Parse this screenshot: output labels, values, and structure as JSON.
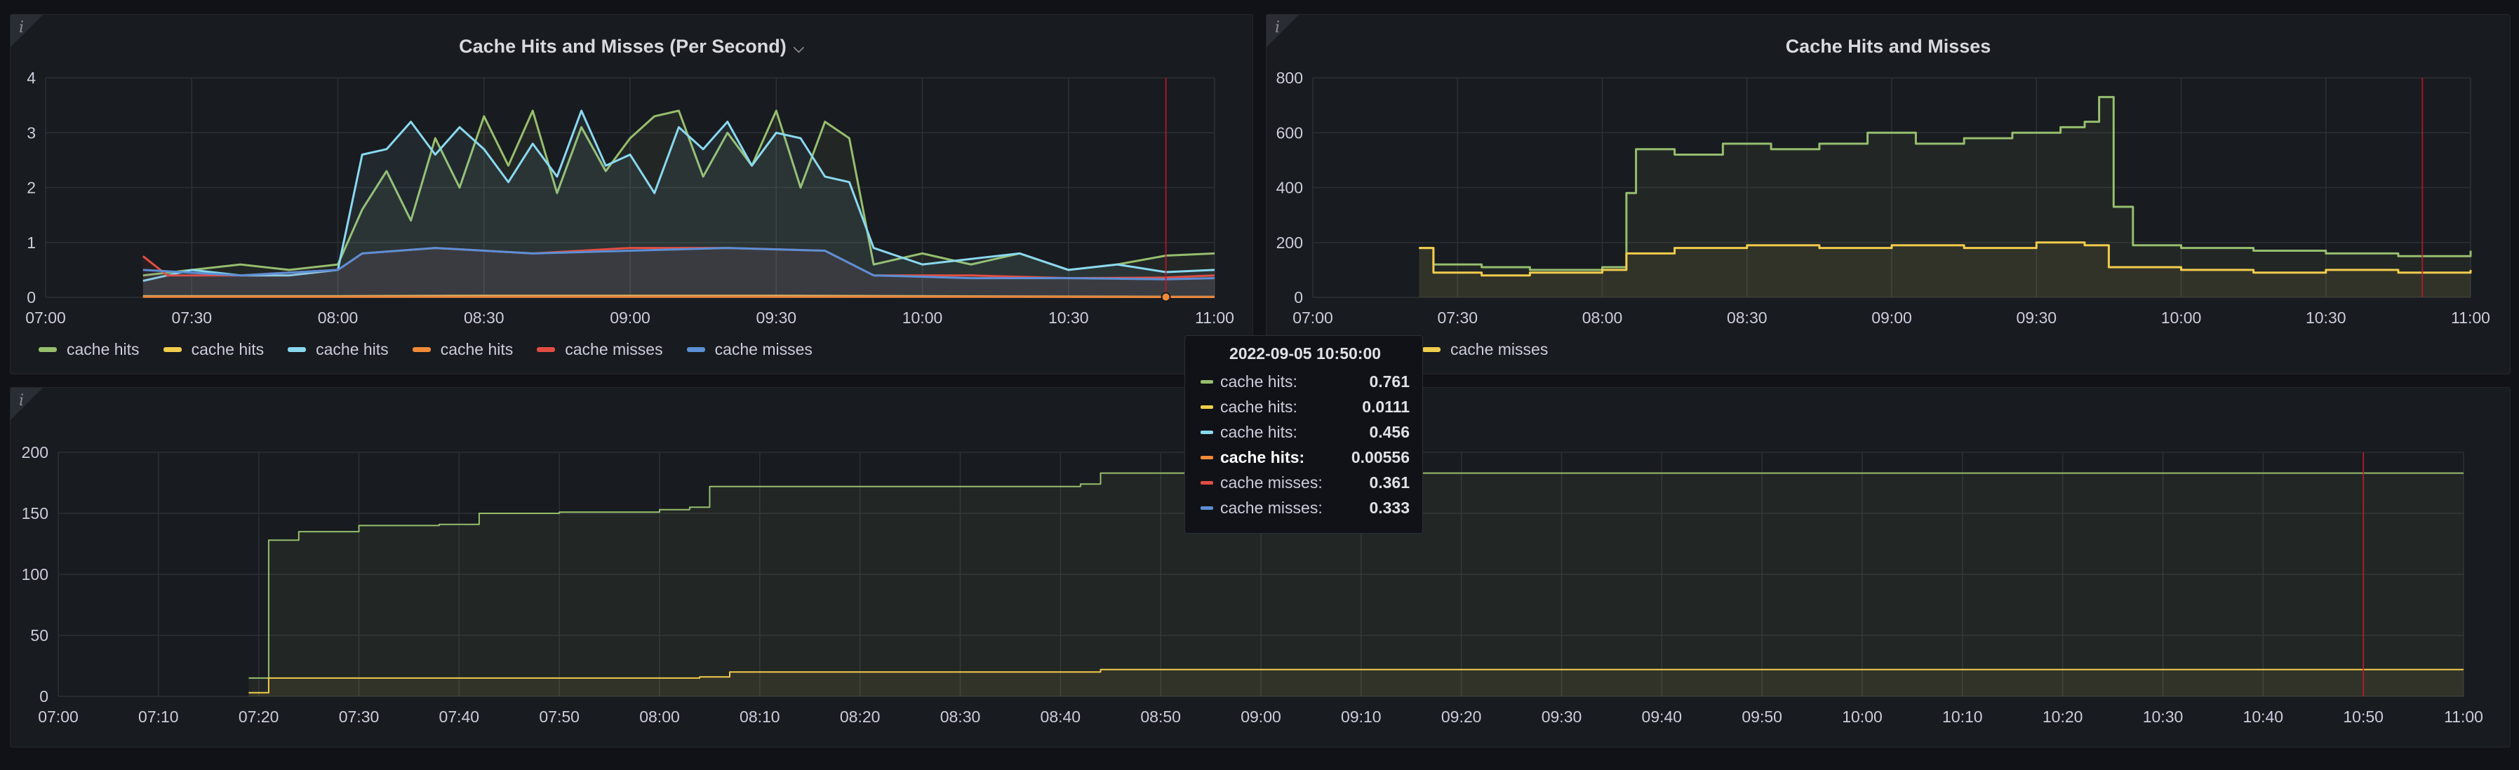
{
  "panels": {
    "top_left": {
      "title": "Cache Hits and Misses (Per Second)",
      "chevron": "⌵",
      "info_icon": "i"
    },
    "top_right": {
      "title": "Cache Hits and Misses",
      "info_icon": "i"
    },
    "bottom": {
      "title": "",
      "info_icon": "i"
    }
  },
  "legend": [
    {
      "label": "cache hits",
      "color": "#96be6e"
    },
    {
      "label": "cache hits",
      "color": "#f2cc4c"
    },
    {
      "label": "cache hits",
      "color": "#8ad8f0"
    },
    {
      "label": "cache hits",
      "color": "#f08a38"
    },
    {
      "label": "cache misses",
      "color": "#e24d42"
    },
    {
      "label": "cache misses",
      "color": "#5b8fd6"
    }
  ],
  "legend_right_partial": {
    "label": "cache misses",
    "color": "#f2cc4c"
  },
  "tooltip": {
    "time": "2022-09-05 10:50:00",
    "rows": [
      {
        "label": "cache hits:",
        "value": "0.761",
        "color": "#96be6e",
        "highlight": false
      },
      {
        "label": "cache hits:",
        "value": "0.0111",
        "color": "#f2cc4c",
        "highlight": false
      },
      {
        "label": "cache hits:",
        "value": "0.456",
        "color": "#8ad8f0",
        "highlight": false
      },
      {
        "label": "cache hits:",
        "value": "0.00556",
        "color": "#f08a38",
        "highlight": true
      },
      {
        "label": "cache misses:",
        "value": "0.361",
        "color": "#e24d42",
        "highlight": false
      },
      {
        "label": "cache misses:",
        "value": "0.333",
        "color": "#5b8fd6",
        "highlight": false
      }
    ]
  },
  "chart_data": [
    {
      "id": "rate",
      "type": "line",
      "title": "Cache Hits and Misses (Per Second)",
      "ylim": [
        0,
        4
      ],
      "yticks": [
        0,
        1,
        2,
        3,
        4
      ],
      "xlim": [
        "07:00",
        "11:00"
      ],
      "xticks": [
        "07:00",
        "07:30",
        "08:00",
        "08:30",
        "09:00",
        "09:30",
        "10:00",
        "10:30",
        "11:00"
      ],
      "cursor": "10:50",
      "grid": true,
      "legend_position": "bottom",
      "series": [
        {
          "name": "cache hits",
          "color": "#96be6e",
          "points": [
            [
              "07:20",
              0.4
            ],
            [
              "07:30",
              0.5
            ],
            [
              "07:40",
              0.6
            ],
            [
              "07:50",
              0.5
            ],
            [
              "08:00",
              0.6
            ],
            [
              "08:05",
              1.6
            ],
            [
              "08:10",
              2.3
            ],
            [
              "08:15",
              1.4
            ],
            [
              "08:20",
              2.9
            ],
            [
              "08:25",
              2.0
            ],
            [
              "08:30",
              3.3
            ],
            [
              "08:35",
              2.4
            ],
            [
              "08:40",
              3.4
            ],
            [
              "08:45",
              1.9
            ],
            [
              "08:50",
              3.1
            ],
            [
              "08:55",
              2.3
            ],
            [
              "09:00",
              2.9
            ],
            [
              "09:05",
              3.3
            ],
            [
              "09:10",
              3.4
            ],
            [
              "09:15",
              2.2
            ],
            [
              "09:20",
              3.0
            ],
            [
              "09:25",
              2.4
            ],
            [
              "09:30",
              3.4
            ],
            [
              "09:35",
              2.0
            ],
            [
              "09:40",
              3.2
            ],
            [
              "09:45",
              2.9
            ],
            [
              "09:50",
              0.6
            ],
            [
              "10:00",
              0.8
            ],
            [
              "10:10",
              0.6
            ],
            [
              "10:20",
              0.8
            ],
            [
              "10:30",
              0.5
            ],
            [
              "10:40",
              0.6
            ],
            [
              "10:50",
              0.76
            ],
            [
              "11:00",
              0.8
            ]
          ]
        },
        {
          "name": "cache hits",
          "color": "#f2cc4c",
          "points": [
            [
              "07:20",
              0.02
            ],
            [
              "08:00",
              0.02
            ],
            [
              "08:30",
              0.03
            ],
            [
              "09:00",
              0.03
            ],
            [
              "09:30",
              0.03
            ],
            [
              "10:00",
              0.02
            ],
            [
              "10:50",
              0.01
            ],
            [
              "11:00",
              0.01
            ]
          ]
        },
        {
          "name": "cache hits",
          "color": "#8ad8f0",
          "points": [
            [
              "07:20",
              0.3
            ],
            [
              "07:30",
              0.5
            ],
            [
              "07:40",
              0.4
            ],
            [
              "07:50",
              0.4
            ],
            [
              "08:00",
              0.5
            ],
            [
              "08:05",
              2.6
            ],
            [
              "08:10",
              2.7
            ],
            [
              "08:15",
              3.2
            ],
            [
              "08:20",
              2.6
            ],
            [
              "08:25",
              3.1
            ],
            [
              "08:30",
              2.7
            ],
            [
              "08:35",
              2.1
            ],
            [
              "08:40",
              2.8
            ],
            [
              "08:45",
              2.2
            ],
            [
              "08:50",
              3.4
            ],
            [
              "08:55",
              2.4
            ],
            [
              "09:00",
              2.6
            ],
            [
              "09:05",
              1.9
            ],
            [
              "09:10",
              3.1
            ],
            [
              "09:15",
              2.7
            ],
            [
              "09:20",
              3.2
            ],
            [
              "09:25",
              2.4
            ],
            [
              "09:30",
              3.0
            ],
            [
              "09:35",
              2.9
            ],
            [
              "09:40",
              2.2
            ],
            [
              "09:45",
              2.1
            ],
            [
              "09:50",
              0.9
            ],
            [
              "10:00",
              0.6
            ],
            [
              "10:10",
              0.7
            ],
            [
              "10:20",
              0.8
            ],
            [
              "10:30",
              0.5
            ],
            [
              "10:40",
              0.6
            ],
            [
              "10:50",
              0.46
            ],
            [
              "11:00",
              0.5
            ]
          ]
        },
        {
          "name": "cache hits",
          "color": "#f08a38",
          "points": [
            [
              "07:20",
              0.01
            ],
            [
              "08:00",
              0.01
            ],
            [
              "09:00",
              0.01
            ],
            [
              "10:00",
              0.01
            ],
            [
              "10:50",
              0.006
            ],
            [
              "11:00",
              0.006
            ]
          ]
        },
        {
          "name": "cache misses",
          "color": "#e24d42",
          "points": [
            [
              "07:20",
              0.75
            ],
            [
              "07:25",
              0.4
            ],
            [
              "07:40",
              0.4
            ],
            [
              "08:00",
              0.5
            ],
            [
              "08:05",
              0.8
            ],
            [
              "08:20",
              0.9
            ],
            [
              "08:40",
              0.8
            ],
            [
              "09:00",
              0.9
            ],
            [
              "09:20",
              0.9
            ],
            [
              "09:40",
              0.85
            ],
            [
              "09:50",
              0.4
            ],
            [
              "10:10",
              0.4
            ],
            [
              "10:30",
              0.35
            ],
            [
              "10:50",
              0.36
            ],
            [
              "11:00",
              0.4
            ]
          ]
        },
        {
          "name": "cache misses",
          "color": "#5b8fd6",
          "points": [
            [
              "07:20",
              0.5
            ],
            [
              "07:40",
              0.4
            ],
            [
              "08:00",
              0.5
            ],
            [
              "08:05",
              0.8
            ],
            [
              "08:20",
              0.9
            ],
            [
              "08:40",
              0.8
            ],
            [
              "09:00",
              0.85
            ],
            [
              "09:20",
              0.9
            ],
            [
              "09:40",
              0.85
            ],
            [
              "09:50",
              0.4
            ],
            [
              "10:10",
              0.35
            ],
            [
              "10:30",
              0.35
            ],
            [
              "10:50",
              0.33
            ],
            [
              "11:00",
              0.35
            ]
          ]
        }
      ]
    },
    {
      "id": "count_step",
      "type": "line",
      "title": "Cache Hits and Misses",
      "ylim": [
        0,
        800
      ],
      "yticks": [
        0,
        200,
        400,
        600,
        800
      ],
      "xlim": [
        "07:00",
        "11:00"
      ],
      "xticks": [
        "07:00",
        "07:30",
        "08:00",
        "08:30",
        "09:00",
        "09:30",
        "10:00",
        "10:30",
        "11:00"
      ],
      "cursor": "10:50",
      "grid": true,
      "series": [
        {
          "name": "cache hits",
          "color": "#96be6e",
          "points": [
            [
              "07:22",
              180
            ],
            [
              "07:25",
              120
            ],
            [
              "07:35",
              110
            ],
            [
              "07:45",
              100
            ],
            [
              "08:00",
              110
            ],
            [
              "08:05",
              380
            ],
            [
              "08:07",
              540
            ],
            [
              "08:15",
              520
            ],
            [
              "08:25",
              560
            ],
            [
              "08:35",
              540
            ],
            [
              "08:45",
              560
            ],
            [
              "08:55",
              600
            ],
            [
              "09:05",
              560
            ],
            [
              "09:15",
              580
            ],
            [
              "09:25",
              600
            ],
            [
              "09:35",
              620
            ],
            [
              "09:40",
              640
            ],
            [
              "09:43",
              730
            ],
            [
              "09:46",
              330
            ],
            [
              "09:50",
              190
            ],
            [
              "10:00",
              180
            ],
            [
              "10:15",
              170
            ],
            [
              "10:30",
              160
            ],
            [
              "10:45",
              150
            ],
            [
              "11:00",
              170
            ]
          ]
        },
        {
          "name": "cache misses",
          "color": "#f2cc4c",
          "points": [
            [
              "07:22",
              180
            ],
            [
              "07:25",
              90
            ],
            [
              "07:35",
              80
            ],
            [
              "07:45",
              90
            ],
            [
              "08:00",
              100
            ],
            [
              "08:05",
              160
            ],
            [
              "08:15",
              180
            ],
            [
              "08:30",
              190
            ],
            [
              "08:45",
              180
            ],
            [
              "09:00",
              190
            ],
            [
              "09:15",
              180
            ],
            [
              "09:30",
              200
            ],
            [
              "09:40",
              190
            ],
            [
              "09:45",
              110
            ],
            [
              "10:00",
              100
            ],
            [
              "10:15",
              90
            ],
            [
              "10:30",
              100
            ],
            [
              "10:45",
              90
            ],
            [
              "11:00",
              100
            ]
          ]
        }
      ]
    },
    {
      "id": "cumulative",
      "type": "area",
      "ylim": [
        0,
        200
      ],
      "yticks": [
        0,
        50,
        100,
        150,
        200
      ],
      "xlim": [
        "07:00",
        "11:00"
      ],
      "xticks": [
        "07:00",
        "07:10",
        "07:20",
        "07:30",
        "07:40",
        "07:50",
        "08:00",
        "08:10",
        "08:20",
        "08:30",
        "08:40",
        "08:50",
        "09:00",
        "09:10",
        "09:20",
        "09:30",
        "09:40",
        "09:50",
        "10:00",
        "10:10",
        "10:20",
        "10:30",
        "10:40",
        "10:50",
        "11:00"
      ],
      "cursor": "10:50",
      "grid": true,
      "series": [
        {
          "name": "cache hits",
          "color": "#96be6e",
          "points": [
            [
              "07:19",
              15
            ],
            [
              "07:21",
              128
            ],
            [
              "07:24",
              135
            ],
            [
              "07:29",
              135
            ],
            [
              "07:30",
              140
            ],
            [
              "07:38",
              141
            ],
            [
              "07:42",
              150
            ],
            [
              "07:50",
              151
            ],
            [
              "08:00",
              153
            ],
            [
              "08:03",
              155
            ],
            [
              "08:05",
              172
            ],
            [
              "08:42",
              174
            ],
            [
              "08:44",
              183
            ],
            [
              "11:00",
              183
            ]
          ]
        },
        {
          "name": "cache misses",
          "color": "#f2cc4c",
          "points": [
            [
              "07:19",
              3
            ],
            [
              "07:21",
              15
            ],
            [
              "08:04",
              16
            ],
            [
              "08:07",
              20
            ],
            [
              "08:42",
              20
            ],
            [
              "08:44",
              22
            ],
            [
              "11:00",
              22
            ]
          ]
        }
      ]
    }
  ]
}
